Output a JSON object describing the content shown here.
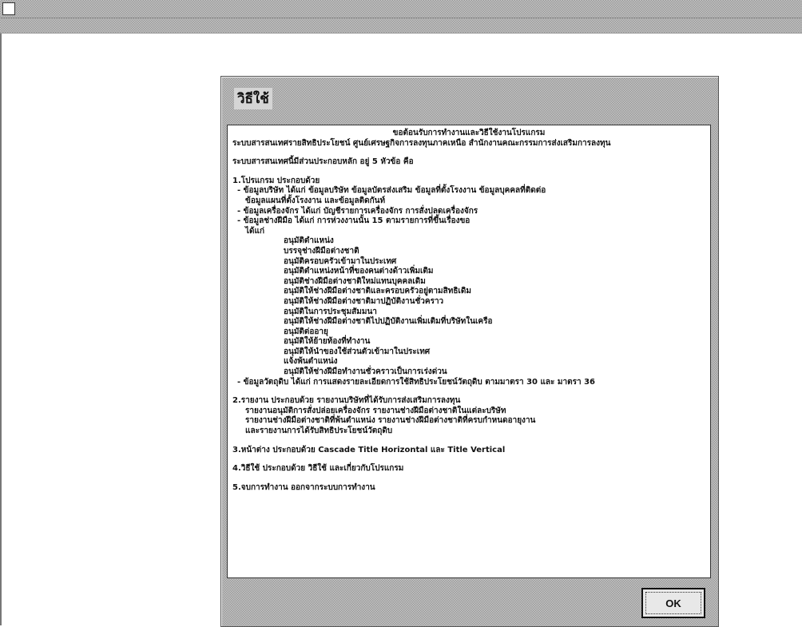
{
  "window": {
    "title": ""
  },
  "menu": {
    "items": [
      "",
      "",
      "",
      "",
      ""
    ]
  },
  "dialog": {
    "title": "วิธีใช้",
    "ok_label": "OK",
    "header_line1": "ขอต้อนรับการทำงานและวิธีใช้งานโปรแกรม",
    "header_line2": "ระบบสารสนเทศรายสิทธิประโยชน์ ศูนย์เศรษฐกิจการลงทุนภาคเหนือ สำนักงานคณะกรรมการส่งเสริมการลงทุน",
    "intro": "ระบบสารสนเทศนี้มีส่วนประกอบหลัก อยู่ 5 หัวข้อ คือ",
    "s1": {
      "heading": "1.โปรแกรม ประกอบด้วย",
      "l1": "- ข้อมูลบริษัท ได้แก่ ข้อมูลบริษัท ข้อมูลบัตรส่งเสริม ข้อมูลที่ตั้งโรงงาน ข้อมูลบุคคลที่ติดต่อ",
      "l2": "ข้อมูลแผนที่ตั้งโรงงาน และข้อมูลติดกันท์",
      "l3": "- ข้อมูลเครื่องจักร ได้แก่ บัญชีรายการเครื่องจักร การสั่งปลดเครื่องจักร",
      "l4": "- ข้อมูลช่างฝีมือ ได้แก่ การห่วงงานนั้น 15 ตามรายการที่ขึ้นเรื่องขอ",
      "l5": "ได้แก่",
      "items": [
        "อนุมัติตำแหน่ง",
        "บรรจุช่างฝีมือต่างชาติ",
        "อนุมัติครอบครัวเข้ามาในประเทศ",
        "อนุมัติตำแหน่งหน้าที่ของคนต่างด้าวเพิ่มเติม",
        "อนุมัติช่างฝีมือต่างชาติใหม่แทนบุคคลเดิม",
        "อนุมัติให้ช่างฝีมือต่างชาติและครอบครัวอยู่ตามสิทธิเดิม",
        "อนุมัติให้ช่างฝีมือต่างชาติมาปฏิบัติงานชั่วคราว",
        "อนุมัติในการประชุมสัมมนา",
        "อนุมัติให้ช่างฝีมือต่างชาติไปปฏิบัติงานเพิ่มเติมที่บริษัทในเครือ",
        "อนุมัติต่ออายุ",
        "อนุมัติให้ย้ายท้องที่ทำงาน",
        "อนุมัติให้นำของใช้ส่วนตัวเข้ามาในประเทศ",
        "แจ้งพ้นตำแหน่ง",
        "อนุมัติให้ช่างฝีมือทำงานชั่วคราวเป็นการเร่งด่วน"
      ],
      "l6": "- ข้อมูลวัตถุดิบ ได้แก่ การแสดงรายละเอียดการใช้สิทธิประโยชน์วัตถุดิบ ตามมาตรา 30 และ มาตรา 36"
    },
    "s2": {
      "heading": "2.รายงาน ประกอบด้วย รายงานบริษัทที่ได้รับการส่งเสริมการลงทุน",
      "l1": "รายงานอนุมัติการสั่งปล่อยเครื่องจักร รายงานช่างฝีมือต่างชาติในแต่ละบริษัท",
      "l2": "รายงานช่างฝีมือต่างชาติที่พ้นตำแหน่ง รายงานช่างฝีมือต่างชาติที่ครบกำหนดอายุงาน",
      "l3": "และรายงานการได้รับสิทธิประโยชน์วัตถุดิบ"
    },
    "s3": "3.หน้าต่าง ประกอบด้วย Cascade Title Horizontal และ Title Vertical",
    "s4": "4.วิธีใช้ ประกอบด้วย วิธีใช้ และเกี่ยวกับโปรแกรม",
    "s5": "5.จบการทำงาน ออกจากระบบการทำงาน"
  },
  "workspace": {
    "scribbles": [
      "",
      "",
      "",
      "",
      "",
      "",
      "",
      ""
    ]
  }
}
